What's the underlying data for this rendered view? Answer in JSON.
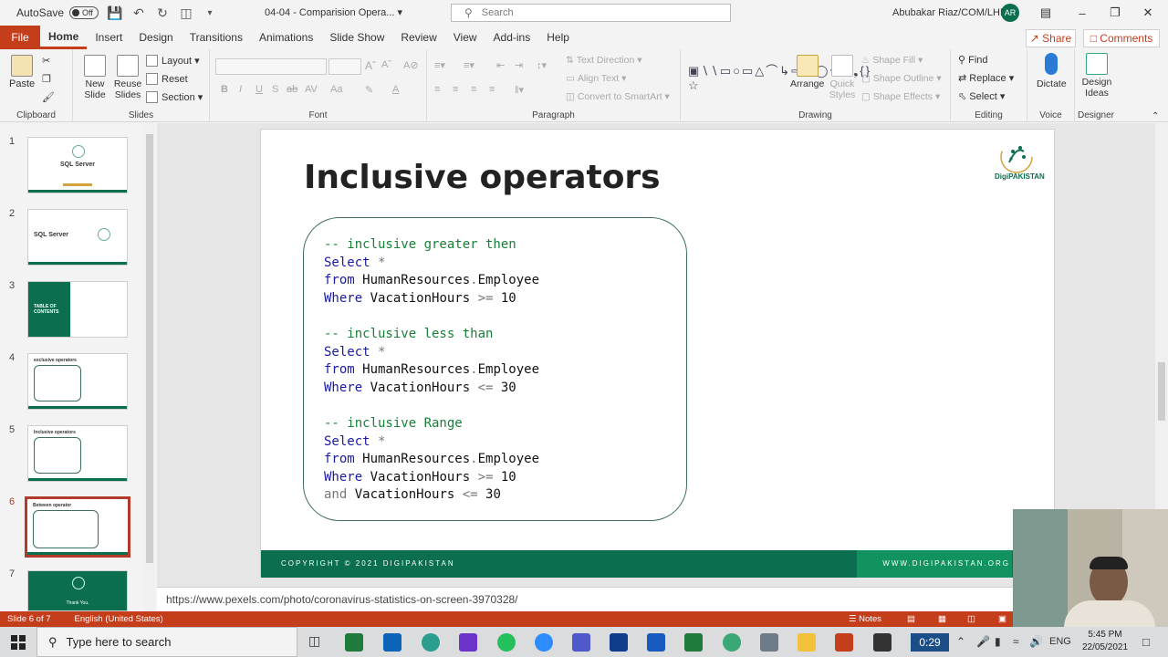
{
  "titlebar": {
    "autosave_label": "AutoSave",
    "autosave_state": "Off",
    "doc_title": "04-04 - Comparision Opera...",
    "search_placeholder": "Search",
    "user_name": "Abubakar Riaz/COM/LHR",
    "user_initials": "AR"
  },
  "tabs": [
    "File",
    "Home",
    "Insert",
    "Design",
    "Transitions",
    "Animations",
    "Slide Show",
    "Review",
    "View",
    "Add-ins",
    "Help"
  ],
  "active_tab": "Home",
  "share_label": "Share",
  "comments_label": "Comments",
  "ribbon": {
    "clipboard": {
      "paste": "Paste",
      "group": "Clipboard"
    },
    "slides": {
      "new_slide": "New Slide",
      "reuse": "Reuse Slides",
      "layout": "Layout",
      "reset": "Reset",
      "section": "Section",
      "group": "Slides"
    },
    "font": {
      "group": "Font"
    },
    "paragraph": {
      "text_direction": "Text Direction",
      "align_text": "Align Text",
      "convert": "Convert to SmartArt",
      "group": "Paragraph"
    },
    "drawing": {
      "arrange": "Arrange",
      "quick_styles": "Quick Styles",
      "shape_fill": "Shape Fill",
      "shape_outline": "Shape Outline",
      "shape_effects": "Shape Effects",
      "group": "Drawing"
    },
    "editing": {
      "find": "Find",
      "replace": "Replace",
      "select": "Select",
      "group": "Editing"
    },
    "voice": {
      "dictate": "Dictate",
      "group": "Voice"
    },
    "designer": {
      "design_ideas": "Design Ideas",
      "group": "Designer"
    }
  },
  "thumbnails": [
    {
      "num": "1",
      "title": "SQL Server"
    },
    {
      "num": "2",
      "title": "SQL Server"
    },
    {
      "num": "3",
      "title": "TABLE OF CONTENTS"
    },
    {
      "num": "4",
      "title": "exclusive operators"
    },
    {
      "num": "5",
      "title": "Inclusive operators"
    },
    {
      "num": "6",
      "title": "Between operator"
    },
    {
      "num": "7",
      "title": "Thank You."
    }
  ],
  "slide": {
    "title": "Inclusive operators",
    "logo_text": "DigiPAKISTAN",
    "code": {
      "c1": "-- inclusive greater then",
      "c2": "-- inclusive less than",
      "c3": "-- inclusive Range",
      "select": "Select",
      "star": " *",
      "from": "from",
      "table": " HumanResources",
      "dot": ".",
      "employee": "Employee",
      "where": "Where",
      "vh": " VacationHours ",
      "gte": ">=",
      "lte": "<=",
      "v10": " 10",
      "v30": " 30",
      "and": "and",
      "vh2": " VacationHours "
    },
    "footer_copy": "COPYRIGHT © 2021 DIGIPAKISTAN",
    "footer_www": "WWW.DIGIPAKISTAN.ORG"
  },
  "notes_url": "https://www.pexels.com/photo/coronavirus-statistics-on-screen-3970328/",
  "status": {
    "slide_of": "Slide 6 of 7",
    "language": "English (United States)",
    "notes": "Notes"
  },
  "taskbar": {
    "search": "Type here to search",
    "timer": "0:29",
    "lang": "ENG",
    "time": "5:45 PM",
    "date": "22/05/2021"
  }
}
